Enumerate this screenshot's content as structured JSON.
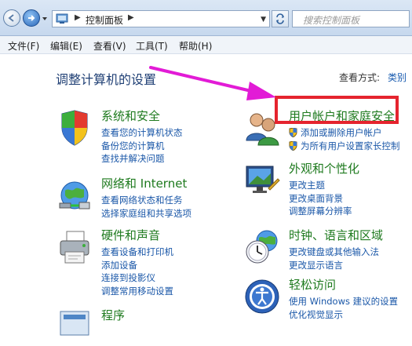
{
  "address_bar": {
    "breadcrumb": "控制面板"
  },
  "search": {
    "placeholder": "搜索控制面板"
  },
  "menu": [
    "文件(F)",
    "编辑(E)",
    "查看(V)",
    "工具(T)",
    "帮助(H)"
  ],
  "page": {
    "title": "调整计算机的设置",
    "view_by_label": "查看方式:",
    "view_by_value": "类别"
  },
  "categories_left": [
    {
      "title": "系统和安全",
      "icon": "shield-flag-icon",
      "links": [
        "查看您的计算机状态",
        "备份您的计算机",
        "查找并解决问题"
      ]
    },
    {
      "title": "网络和 Internet",
      "icon": "network-globe-icon",
      "links": [
        "查看网络状态和任务",
        "选择家庭组和共享选项"
      ]
    },
    {
      "title": "硬件和声音",
      "icon": "printer-icon",
      "links": [
        "查看设备和打印机",
        "添加设备",
        "连接到投影仪",
        "调整常用移动设置"
      ]
    },
    {
      "title": "程序",
      "icon": "programs-icon",
      "links": []
    }
  ],
  "categories_right": [
    {
      "title": "用户帐户和家庭安全",
      "icon": "users-icon",
      "links": [
        "添加或删除用户帐户",
        "为所有用户设置家长控制"
      ]
    },
    {
      "title": "外观和个性化",
      "icon": "display-icon",
      "links": [
        "更改主题",
        "更改桌面背景",
        "调整屏幕分辨率"
      ]
    },
    {
      "title": "时钟、语言和区域",
      "icon": "clock-globe-icon",
      "links": [
        "更改键盘或其他输入法",
        "更改显示语言"
      ]
    },
    {
      "title": "轻松访问",
      "icon": "ease-of-access-icon",
      "links": [
        "使用 Windows 建议的设置",
        "优化视觉显示"
      ]
    }
  ],
  "colors": {
    "category_title": "#1e7a1e",
    "link": "#1a57a8",
    "page_title": "#1f3f74",
    "annotation": "#e5242e"
  }
}
